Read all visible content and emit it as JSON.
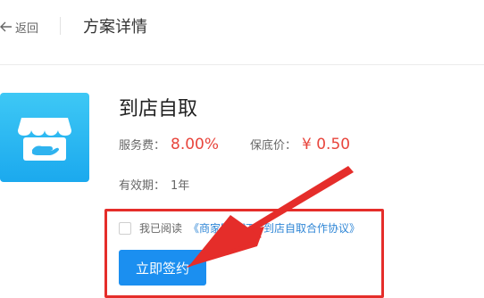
{
  "header": {
    "back_label": "返回",
    "title": "方案详情"
  },
  "product": {
    "icon": "storefront-hand-icon",
    "name": "到店自取",
    "fee_label": "服务费：",
    "fee_value": "8.00%",
    "floor_label": "保底价：",
    "floor_value": "¥ 0.50",
    "validity_label": "有效期：",
    "validity_value": "1年"
  },
  "agreement": {
    "read_label": "我已阅读",
    "link_text": "《商家网上订餐到店自取合作协议》",
    "checked": false
  },
  "actions": {
    "sign_label": "立即签约"
  },
  "colors": {
    "accent": "#1b8ff0",
    "price": "#e8453c",
    "highlight": "#e52d2a",
    "link": "#2f86d6"
  }
}
